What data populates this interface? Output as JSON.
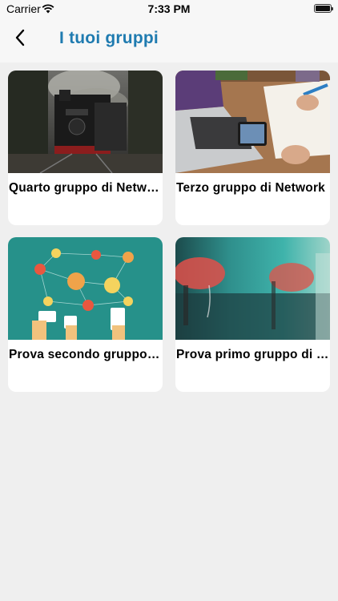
{
  "status_bar": {
    "carrier": "Carrier",
    "time": "7:33 PM"
  },
  "nav": {
    "title": "I tuoi gruppi",
    "back_icon": "chevron-left-icon"
  },
  "groups": [
    {
      "title": "Quarto gruppo di Network",
      "image": "steam-train-photo"
    },
    {
      "title": "Terzo gruppo di Network",
      "image": "laptop-desk-photo"
    },
    {
      "title": "Prova secondo gruppo di Network",
      "image": "social-network-illustration"
    },
    {
      "title": "Prova primo gruppo di Network",
      "image": "abstract-teal-red-photo"
    }
  ],
  "colors": {
    "title_blue": "#1f7bb0",
    "background": "#efefef",
    "card": "#ffffff"
  }
}
